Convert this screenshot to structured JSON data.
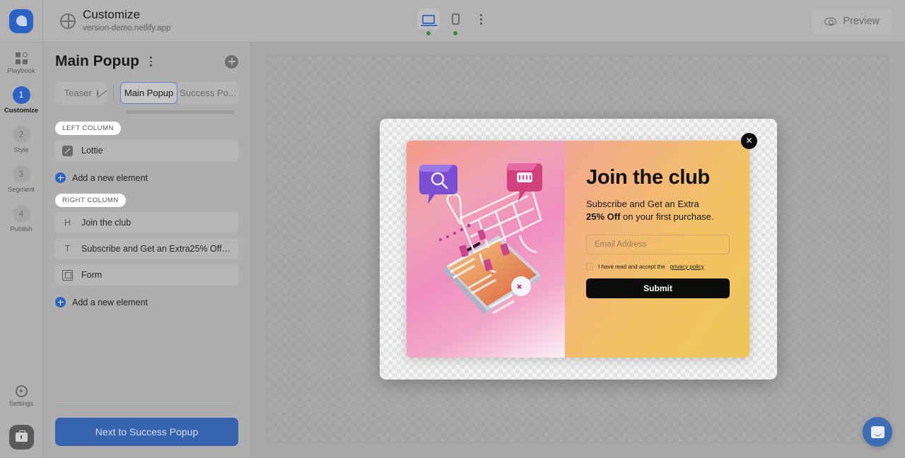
{
  "topbar": {
    "logo_icon": "brand-logo-icon",
    "globe_icon": "globe-icon",
    "site_title": "Customize",
    "site_url": "version-demo.netlify.app",
    "desktop_icon": "desktop-icon",
    "mobile_icon": "mobile-icon",
    "kebab_icon": "more-vertical-icon",
    "preview_label": "Preview",
    "preview_icon": "eye-icon"
  },
  "rail": {
    "playbook": {
      "label": "Playbook",
      "icon": "grid-icon"
    },
    "steps": [
      {
        "num": "1",
        "label": "Customize",
        "active": true
      },
      {
        "num": "2",
        "label": "Style",
        "active": false
      },
      {
        "num": "3",
        "label": "Segment",
        "active": false
      },
      {
        "num": "4",
        "label": "Publish",
        "active": false
      }
    ],
    "settings_label": "Settings",
    "settings_icon": "gear-icon",
    "briefcase_icon": "briefcase-icon"
  },
  "panel": {
    "title": "Main Popup",
    "kebab_icon": "more-vertical-icon",
    "add_icon": "plus-circle-icon",
    "tabs": [
      {
        "label": "Teaser",
        "icon": "eye-off-icon",
        "active": false
      },
      {
        "label": "Main Popup",
        "icon": "",
        "active": true
      },
      {
        "label": "Success Po...",
        "icon": "",
        "active": false
      }
    ],
    "left_column_label": "LEFT COLUMN",
    "right_column_label": "RIGHT COLUMN",
    "left_elements": [
      {
        "label": "Lottie",
        "icon": "lottie-icon"
      }
    ],
    "right_elements": [
      {
        "label": "Join the club",
        "icon": "heading-icon",
        "glyph": "H"
      },
      {
        "label": "Subscribe and Get an Extra25% Off on you...",
        "icon": "text-icon",
        "glyph": "T"
      },
      {
        "label": "Form",
        "icon": "form-icon",
        "glyph": ""
      }
    ],
    "add_element_label": "Add a new element",
    "next_button_label": "Next to Success Popup"
  },
  "popup": {
    "illustration_name": "shopping-cart-phone-illustration",
    "close_icon": "close-icon",
    "title": "Join the club",
    "subtitle_line1": "Subscribe and Get an Extra",
    "subtitle_bold": "25% Off",
    "subtitle_line2": " on your first purchase.",
    "email_placeholder": "Email Address",
    "consent_text": "I have read and accept the ",
    "consent_link": "privacy policy",
    "submit_label": "Submit"
  },
  "chat": {
    "icon": "chat-bubble-icon"
  },
  "colors": {
    "accent_blue": "#2b63c4",
    "button_blue": "#3663ae",
    "status_green": "#2f8f3e",
    "submit_black": "#0c0c0c"
  }
}
